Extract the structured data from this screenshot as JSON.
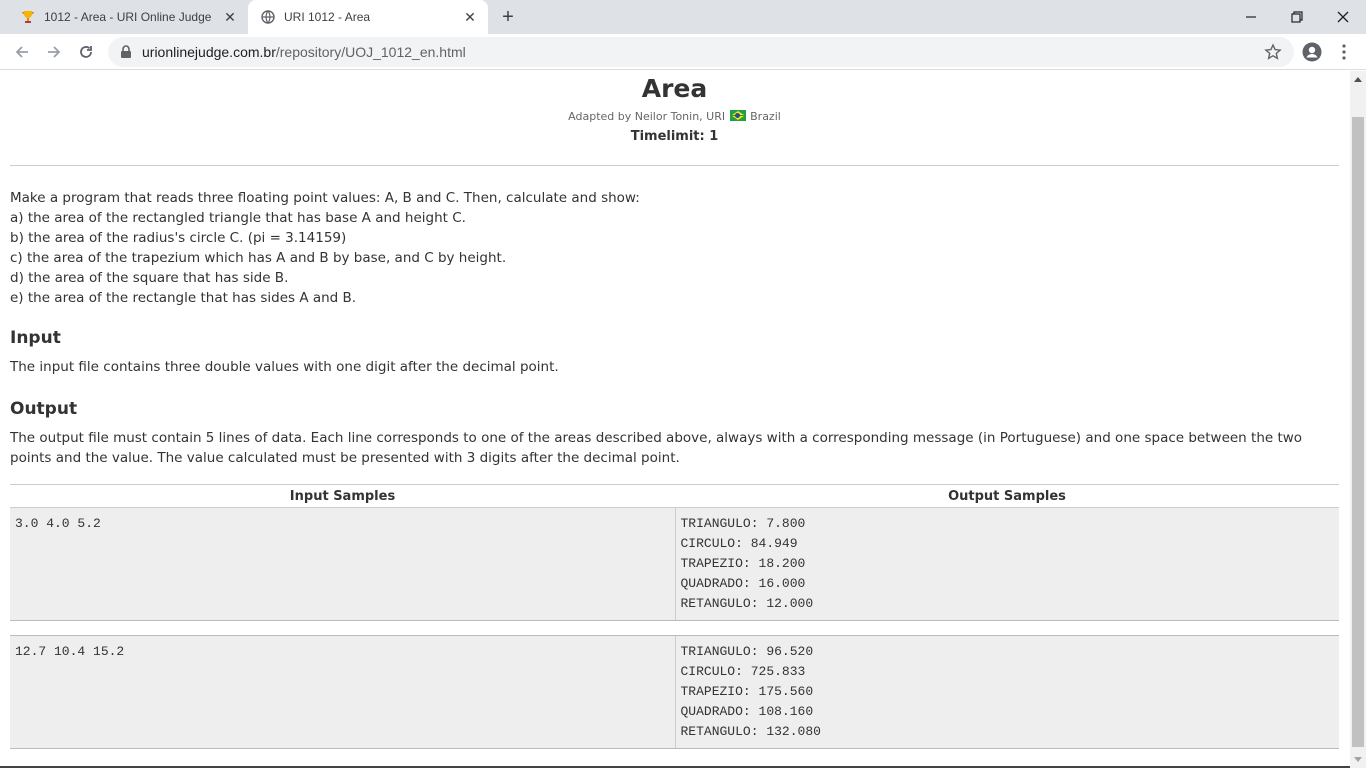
{
  "browser": {
    "tabs": [
      {
        "title": "1012 - Area - URI Online Judge",
        "active": false
      },
      {
        "title": "URI 1012 - Area",
        "active": true
      }
    ],
    "url_host": "urionlinejudge.com.br",
    "url_path": "/repository/UOJ_1012_en.html"
  },
  "problem": {
    "title": "Area",
    "adapted_by": "Adapted by Neilor Tonin, URI",
    "country": "Brazil",
    "timelimit": "Timelimit: 1",
    "description": [
      "Make a program that reads three floating point values: A, B and C. Then, calculate and show:",
      "a) the area of the rectangled triangle that has base A and height C.",
      "b) the area of the radius's circle C. (pi = 3.14159)",
      "c) the area of the trapezium which has A and B by base, and C by height.",
      "d) the area of the square that has side B.",
      "e) the area of the rectangle that has sides A and B."
    ],
    "input_heading": "Input",
    "input_text": "The input file contains three double values with one digit after the decimal point.",
    "output_heading": "Output",
    "output_text": "The output file must contain 5 lines of data. Each line corresponds to one of the areas described above, always with a corresponding message (in Portuguese) and one space between the two points and the value. The value calculated must be presented with 3 digits after the decimal point."
  },
  "samples": {
    "input_header": "Input Samples",
    "output_header": "Output Samples",
    "rows": [
      {
        "input": [
          "3.0 4.0 5.2"
        ],
        "output": [
          "TRIANGULO: 7.800",
          "CIRCULO: 84.949",
          "TRAPEZIO: 18.200",
          "QUADRADO: 16.000",
          "RETANGULO: 12.000"
        ]
      },
      {
        "input": [
          "12.7 10.4 15.2"
        ],
        "output": [
          "TRIANGULO: 96.520",
          "CIRCULO: 725.833",
          "TRAPEZIO: 175.560",
          "QUADRADO: 108.160",
          "RETANGULO: 132.080"
        ]
      }
    ]
  }
}
